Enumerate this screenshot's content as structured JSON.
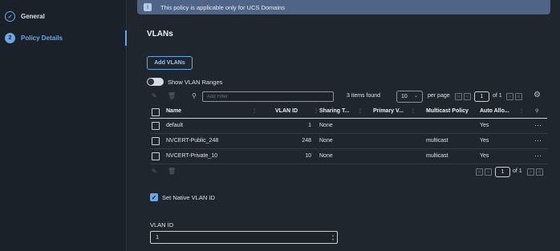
{
  "sidebar": {
    "steps": [
      {
        "label": "General",
        "marker": "✓",
        "state": "done"
      },
      {
        "label": "Policy Details",
        "marker": "2",
        "state": "active"
      }
    ]
  },
  "banner": {
    "text": "This policy is applicable only for UCS Domains",
    "icon": "info-icon"
  },
  "vlans": {
    "title": "VLANs",
    "add_button": "Add VLANs",
    "show_ranges_label": "Show VLAN Ranges",
    "filter_placeholder": "Add Filter",
    "items_found": "3 items found",
    "per_page_value": "10",
    "per_page_label": "per page",
    "page_value": "1",
    "of_label": "of 1",
    "columns": [
      "Name",
      "VLAN ID",
      "Sharing T...",
      "Primary V...",
      "Multicast Policy",
      "Auto Allo..."
    ],
    "rows": [
      {
        "name": "default",
        "vlan_id": "1",
        "sharing": "None",
        "primary": "",
        "multicast": "",
        "auto_allow": "Yes"
      },
      {
        "name": "NVCERT-Public_248",
        "vlan_id": "248",
        "sharing": "None",
        "primary": "",
        "multicast": "multicast",
        "auto_allow": "Yes"
      },
      {
        "name": "NVCERT-Private_10",
        "vlan_id": "10",
        "sharing": "None",
        "primary": "",
        "multicast": "multicast",
        "auto_allow": "Yes"
      }
    ],
    "bottom_page_value": "1",
    "bottom_of_label": "of 1"
  },
  "native": {
    "checkbox_label": "Set Native VLAN ID",
    "checked": true
  },
  "vlan_id_field": {
    "label": "VLAN ID",
    "value": "1"
  },
  "colors": {
    "accent": "#6aa8e8",
    "banner": "#4f6487",
    "background": "#20262d"
  }
}
